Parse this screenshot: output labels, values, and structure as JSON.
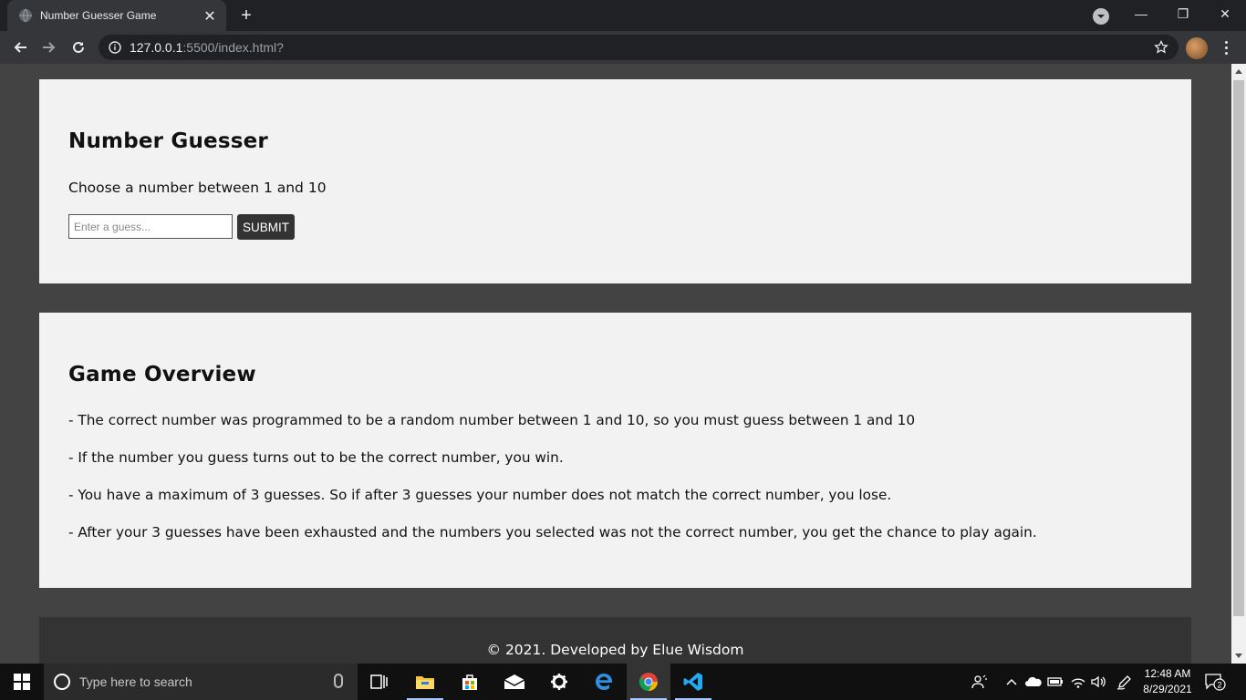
{
  "browser": {
    "tab_title": "Number Guesser Game",
    "tab_close": "✕",
    "new_tab": "+",
    "url_host": "127.0.0.1",
    "url_rest": ":5500/index.html?",
    "window_controls": {
      "minimize": "—",
      "maximize": "❐",
      "close": "✕"
    }
  },
  "game": {
    "title": "Number Guesser",
    "instruction": "Choose a number between 1 and 10",
    "input_placeholder": "Enter a guess...",
    "input_value": "",
    "submit_label": "SUBMIT"
  },
  "overview": {
    "title": "Game Overview",
    "rules": [
      "- The correct number was programmed to be a random number between 1 and 10, so you must guess between 1 and 10",
      "- If the number you guess turns out to be the correct number, you win.",
      "- You have a maximum of 3 guesses. So if after 3 guesses your number does not match the correct number, you lose.",
      "- After your 3 guesses have been exhausted and the numbers you selected was not the correct number, you get the chance to play again."
    ]
  },
  "footer": {
    "text": "© 2021. Developed by Elue Wisdom"
  },
  "taskbar": {
    "search_placeholder": "Type here to search",
    "time": "12:48 AM",
    "date": "8/29/2021",
    "notification_count": "2",
    "pinned_icons": [
      "task-view-icon",
      "file-explorer-icon",
      "microsoft-store-icon",
      "mail-icon",
      "settings-icon",
      "edge-icon",
      "chrome-icon",
      "vscode-icon"
    ]
  },
  "colors": {
    "page_background": "#434343",
    "card_background": "#f2f2f2",
    "footer_background": "#333333",
    "button_background": "#333333"
  }
}
